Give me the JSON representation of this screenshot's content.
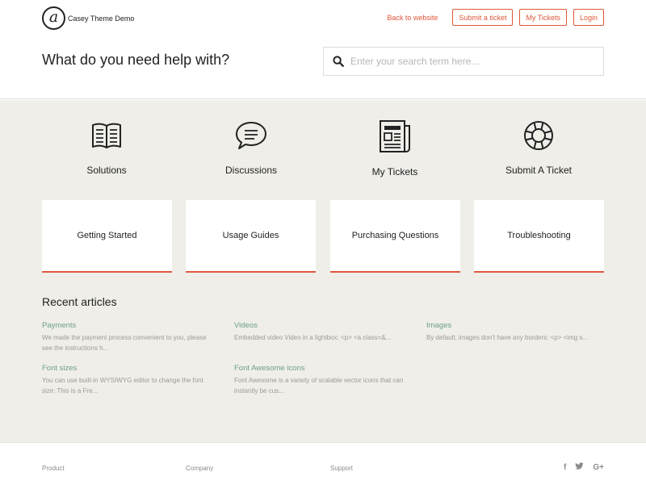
{
  "header": {
    "logo_glyph": "a",
    "site_name": "Casey Theme Demo",
    "nav": {
      "back_to_website": "Back to website",
      "submit_ticket": "Submit a ticket",
      "my_tickets": "My Tickets",
      "login": "Login"
    },
    "accent_color": "#e0573a"
  },
  "hero": {
    "title": "What do you need help with?",
    "search_placeholder": "Enter your search term here..."
  },
  "categories": [
    {
      "label": "Solutions",
      "icon": "book-icon"
    },
    {
      "label": "Discussions",
      "icon": "speech-bubble-icon"
    },
    {
      "label": "My Tickets",
      "icon": "newspaper-icon"
    },
    {
      "label": "Submit A Ticket",
      "icon": "lifebuoy-icon"
    }
  ],
  "topics": [
    "Getting Started",
    "Usage Guides",
    "Purchasing Questions",
    "Troubleshooting"
  ],
  "recent": {
    "title": "Recent articles",
    "articles": [
      {
        "title": "Payments",
        "excerpt": "We made the payment process convenient to you, please see the instructions h..."
      },
      {
        "title": "Videos",
        "excerpt": "Embedded video Video in a lightbox: <p>   <a class=&..."
      },
      {
        "title": "Images",
        "excerpt": "By default, images don't have any borders: <p>   <img s..."
      },
      {
        "title": "Font sizes",
        "excerpt": "You can use built-in WYSIWYG editor to change the font size: This is a Fre..."
      },
      {
        "title": "Font Awesome icons",
        "excerpt": "Font Awesome is a variety of scalable vector icons that can instantly be cus..."
      }
    ]
  },
  "footer": {
    "columns": [
      "Product",
      "Company",
      "Support"
    ],
    "social": {
      "facebook": "f",
      "twitter": "twitter-icon",
      "google_plus": "G+"
    }
  }
}
